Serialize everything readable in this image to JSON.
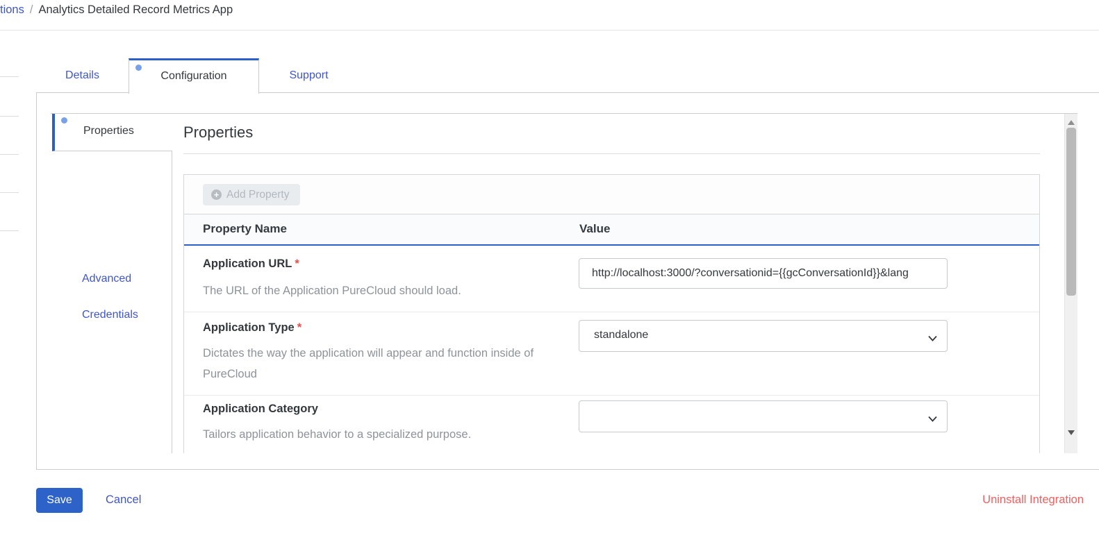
{
  "breadcrumb": {
    "parent": "tions",
    "separator": "/",
    "current": "Analytics Detailed Record Metrics App"
  },
  "tabs": {
    "details": "Details",
    "configuration": "Configuration",
    "support": "Support",
    "active": "Configuration"
  },
  "subnav": {
    "properties": "Properties",
    "advanced": "Advanced",
    "credentials": "Credentials",
    "active": "Properties"
  },
  "content": {
    "heading": "Properties",
    "toolbar": {
      "add_property_label": "Add Property",
      "add_icon_glyph": "+"
    },
    "table": {
      "headers": {
        "name": "Property Name",
        "value": "Value"
      },
      "rows": [
        {
          "name": "Application URL",
          "required": "*",
          "description": "The URL of the Application PureCloud should load.",
          "control": "input",
          "value": "http://localhost:3000/?conversationid={{gcConversationId}}&lang"
        },
        {
          "name": "Application Type",
          "required": "*",
          "description": "Dictates the way the application will appear and function inside of PureCloud",
          "control": "select",
          "value": "standalone"
        },
        {
          "name": "Application Category",
          "required": "",
          "description": "Tailors application behavior to a specialized purpose.",
          "control": "select",
          "value": ""
        }
      ]
    }
  },
  "footer": {
    "save": "Save",
    "cancel": "Cancel",
    "uninstall": "Uninstall Integration"
  },
  "icons": {
    "add_property": "circle-plus",
    "value_dropdown": "chevron-down",
    "scrollbar_top": "triangle-up",
    "scrollbar_bottom": "triangle-down"
  },
  "colors": {
    "accent_blue": "#2a5fc8",
    "link_blue": "#3f56c9",
    "dot_blue": "#79a1e9",
    "save_button_blue": "#2d62c8",
    "required_red": "#ee4c4c",
    "uninstall_red": "#f25f5f",
    "text_dark": "#33383d",
    "text_muted": "#8d9399"
  }
}
